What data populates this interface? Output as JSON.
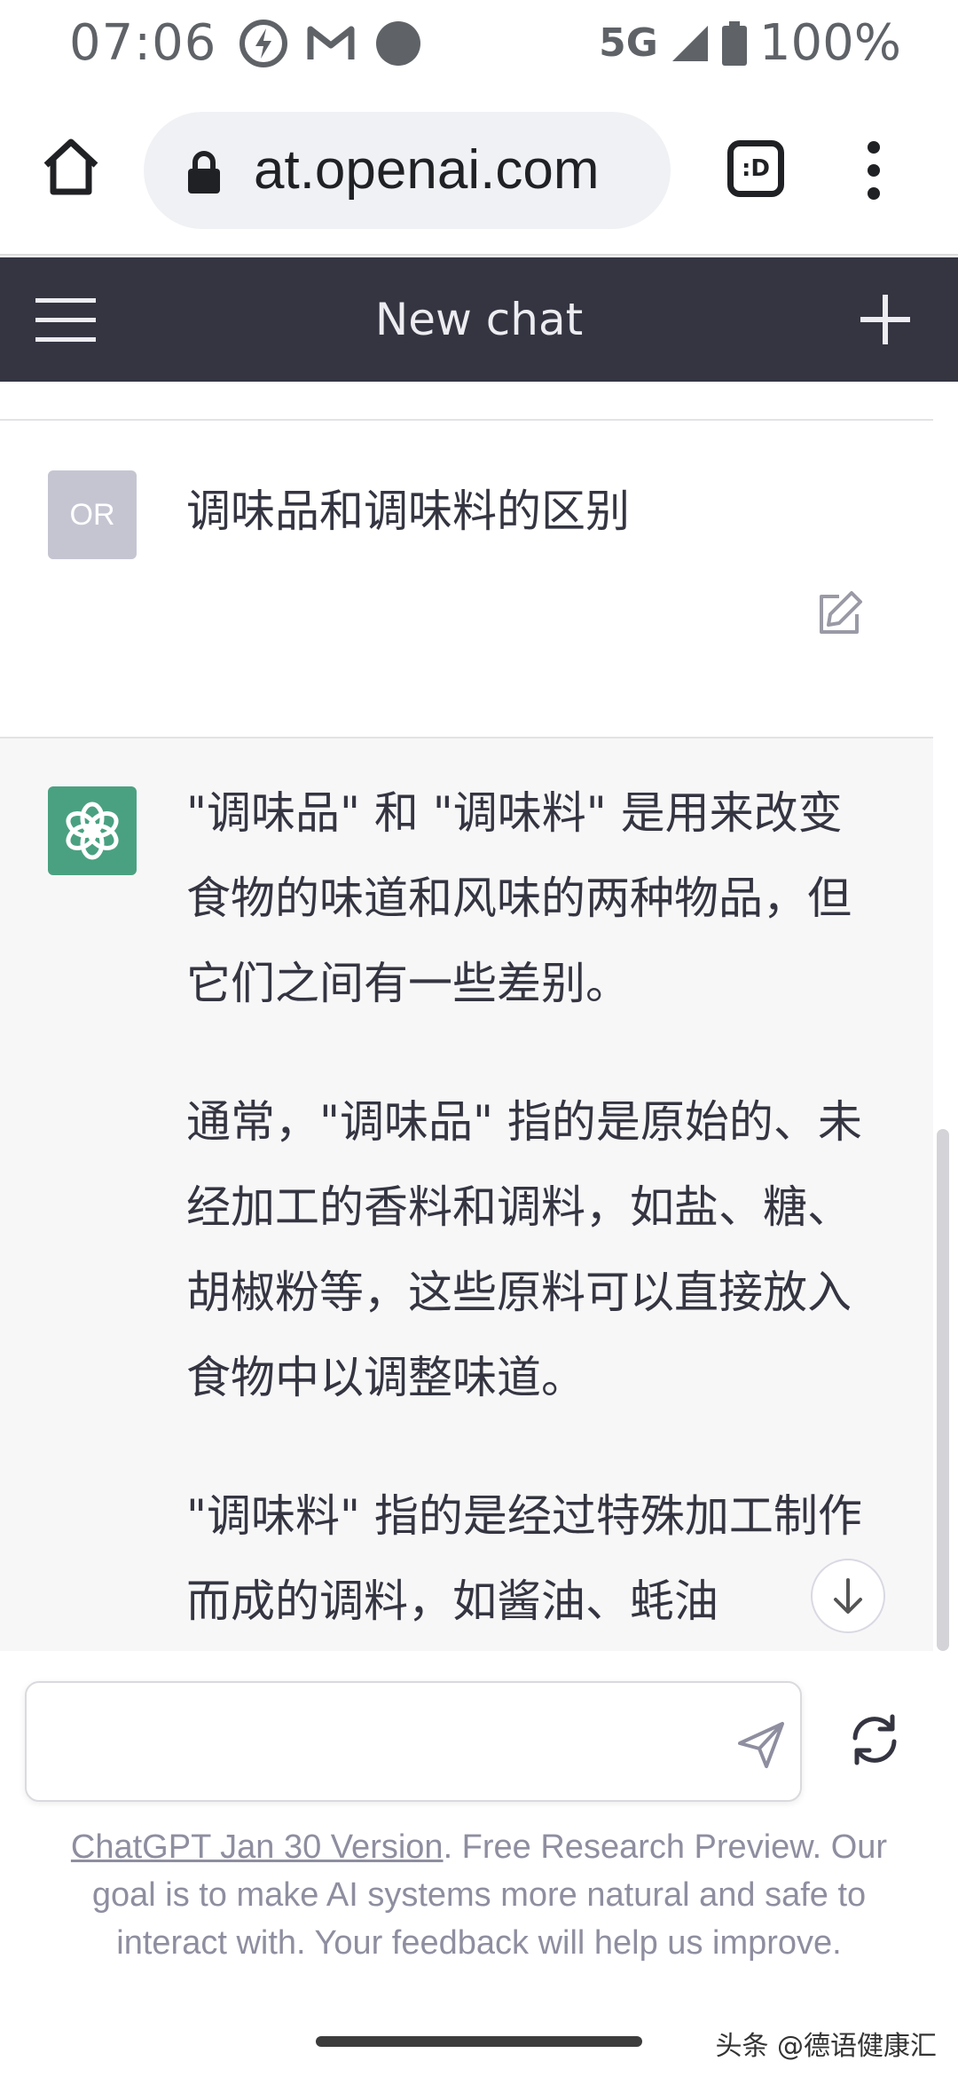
{
  "status_bar": {
    "time": "07:06",
    "network": "5G",
    "battery": "100%",
    "icons": [
      "flash-circle-icon",
      "gmail-icon",
      "dot-icon",
      "signal-icon",
      "battery-icon"
    ]
  },
  "browser": {
    "url": "at.openai.com",
    "tabs_label": ":D",
    "icons": [
      "home-icon",
      "lock-icon",
      "tabs-icon",
      "overflow-menu-icon"
    ]
  },
  "header": {
    "title": "New chat",
    "icons": [
      "hamburger-icon",
      "plus-icon"
    ],
    "bg_color": "#343541"
  },
  "conversation": {
    "user": {
      "avatar_text": "OR",
      "message": "调味品和调味料的区别"
    },
    "assistant": {
      "avatar_color": "#4aa181",
      "paragraphs": [
        "\"调味品\" 和 \"调味料\" 是用来改变食物的味道和风味的两种物品，但它们之间有一些差别。",
        "通常，\"调味品\" 指的是原始的、未经加工的香料和调料，如盐、糖、胡椒粉等，这些原料可以直接放入食物中以调整味道。",
        "\"调味料\" 指的是经过特殊加工制作而成的调料，如酱油、蚝油"
      ]
    }
  },
  "composer": {
    "input_value": "",
    "footer_link": "ChatGPT Jan 30 Version",
    "footer_text": ". Free Research Preview. Our goal is to make AI systems more natural and safe to interact with. Your feedback will help us improve."
  },
  "watermark": "头条 @德语健康汇"
}
